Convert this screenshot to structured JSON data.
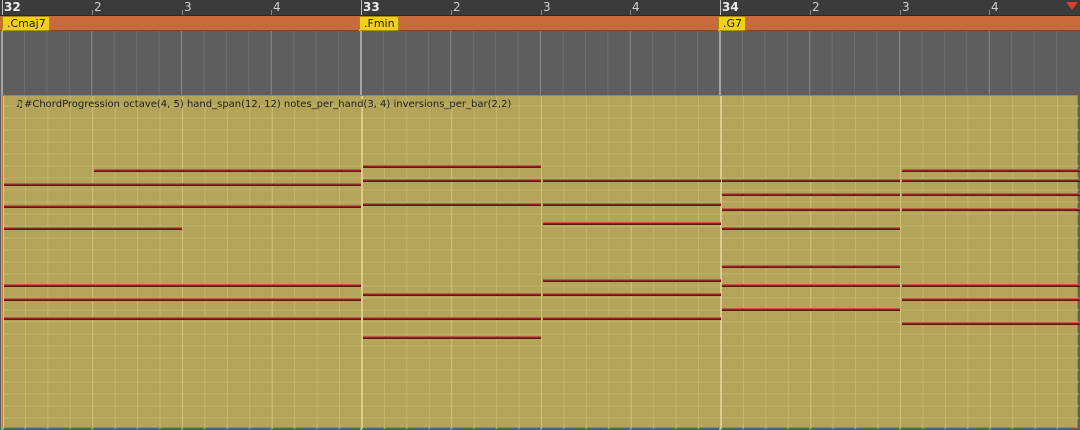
{
  "ruler": {
    "bars": [
      {
        "label": "32"
      },
      {
        "label": "33"
      },
      {
        "label": "34"
      }
    ],
    "beats": [
      "2",
      "3",
      "4"
    ]
  },
  "chord_track": {
    "chords": [
      {
        "label": ".Cmaj7"
      },
      {
        "label": ".Fmin"
      },
      {
        "label": ".G7"
      }
    ]
  },
  "clip": {
    "name": "♫#ChordProgression octave(4, 5) hand_span(12, 12) notes_per_hand(3, 4) inversions_per_bar(2,2)"
  },
  "colors": {
    "ruler_bg": "#3b3b3b",
    "chord_track_bg": "#c86a3c",
    "chord_flag": "#f2cf1c",
    "clip_bg": "#b3a45a",
    "note": "#8a2b22",
    "lane_bg": "#5e5e5e"
  },
  "icons": {
    "loop_end": "loop-end-marker-icon"
  }
}
